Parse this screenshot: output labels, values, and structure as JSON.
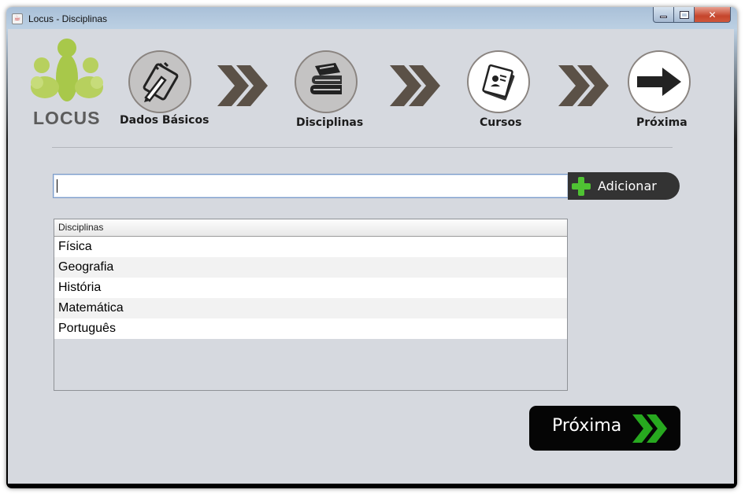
{
  "window": {
    "title": "Locus - Disciplinas",
    "app_icon_glyph": "☕",
    "close_glyph": "✕"
  },
  "logo": {
    "text": "LOCUS"
  },
  "steps": [
    {
      "label": "Dados Básicos",
      "icon": "notepad-pen-icon",
      "state": "done"
    },
    {
      "label": "Disciplinas",
      "icon": "books-icon",
      "state": "current"
    },
    {
      "label": "Cursos",
      "icon": "documents-icon",
      "state": "todo"
    },
    {
      "label": "Próxima",
      "icon": "arrow-right-icon",
      "state": "todo"
    }
  ],
  "form": {
    "input_value": "",
    "add_label": "Adicionar"
  },
  "table": {
    "header": "Disciplinas",
    "rows": [
      "Física",
      "Geografia",
      "História",
      "Matemática",
      "Português"
    ]
  },
  "next": {
    "label": "Próxima"
  },
  "colors": {
    "background": "#d6d9df",
    "accent_green": "#4fc233",
    "logo_green": "#a8c84a",
    "chevron": "#5b5147"
  }
}
